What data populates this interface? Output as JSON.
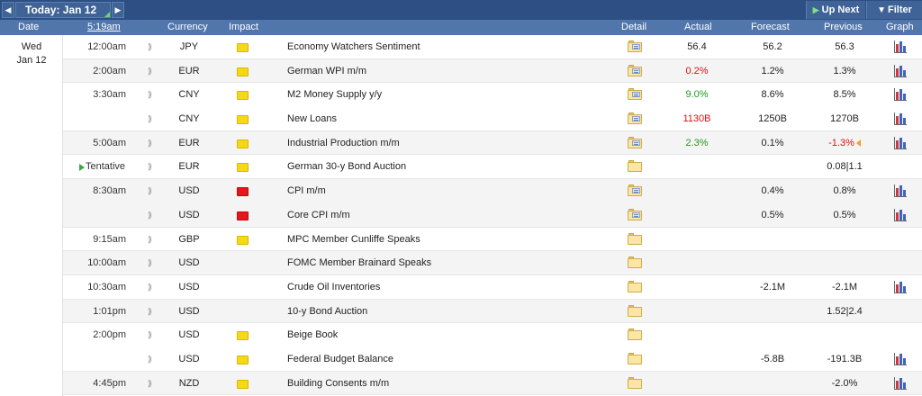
{
  "toolbar": {
    "prev_arrow": "◀",
    "next_arrow": "▶",
    "today_label": "Today: Jan 12",
    "up_next_label": "Up Next",
    "filter_label": "Filter"
  },
  "columns": {
    "date": "Date",
    "time": "5:19am",
    "currency": "Currency",
    "impact": "Impact",
    "detail": "Detail",
    "actual": "Actual",
    "forecast": "Forecast",
    "previous": "Previous",
    "graph": "Graph"
  },
  "date_group": {
    "weekday": "Wed",
    "day": "Jan 12"
  },
  "colors": {
    "header_bar": "#2d4f83",
    "column_bar": "#5076ac",
    "impact_low": "#f5d816",
    "impact_medium": "#f39a31",
    "impact_high": "#e4171b",
    "better_than_forecast": "#229922",
    "worse_than_forecast": "#dd1111"
  },
  "events": [
    {
      "time": "12:00am",
      "currency": "JPY",
      "impact": "low",
      "event": "Economy Watchers Sentiment",
      "detail_icon": "folder-doc-icon",
      "actual": "56.4",
      "actual_status": "",
      "forecast": "56.2",
      "previous": "56.3",
      "previous_status": "",
      "revised": false,
      "graph": true
    },
    {
      "time": "2:00am",
      "currency": "EUR",
      "impact": "low",
      "event": "German WPI m/m",
      "detail_icon": "folder-doc-icon",
      "actual": "0.2%",
      "actual_status": "worse",
      "forecast": "1.2%",
      "previous": "1.3%",
      "previous_status": "",
      "revised": false,
      "graph": true
    },
    {
      "time": "3:30am",
      "currency": "CNY",
      "impact": "low",
      "event": "M2 Money Supply y/y",
      "detail_icon": "folder-doc-icon",
      "actual": "9.0%",
      "actual_status": "better",
      "forecast": "8.6%",
      "previous": "8.5%",
      "previous_status": "",
      "revised": false,
      "graph": true
    },
    {
      "time": "",
      "currency": "CNY",
      "impact": "low",
      "event": "New Loans",
      "detail_icon": "folder-doc-icon",
      "actual": "1130B",
      "actual_status": "worse",
      "forecast": "1250B",
      "previous": "1270B",
      "previous_status": "",
      "revised": false,
      "graph": true
    },
    {
      "time": "5:00am",
      "currency": "EUR",
      "impact": "low",
      "event": "Industrial Production m/m",
      "detail_icon": "folder-doc-icon",
      "actual": "2.3%",
      "actual_status": "better",
      "forecast": "0.1%",
      "previous": "-1.3%",
      "previous_status": "worse",
      "revised": true,
      "graph": true
    },
    {
      "time": "Tentative",
      "currency": "EUR",
      "impact": "low",
      "event": "German 30-y Bond Auction",
      "detail_icon": "folder-icon",
      "actual": "",
      "actual_status": "",
      "forecast": "",
      "previous": "0.08|1.1",
      "previous_status": "",
      "revised": false,
      "graph": false
    },
    {
      "time": "8:30am",
      "currency": "USD",
      "impact": "high",
      "event": "CPI m/m",
      "detail_icon": "folder-doc-icon",
      "actual": "",
      "actual_status": "",
      "forecast": "0.4%",
      "previous": "0.8%",
      "previous_status": "",
      "revised": false,
      "graph": true
    },
    {
      "time": "",
      "currency": "USD",
      "impact": "high",
      "event": "Core CPI m/m",
      "detail_icon": "folder-doc-icon",
      "actual": "",
      "actual_status": "",
      "forecast": "0.5%",
      "previous": "0.5%",
      "previous_status": "",
      "revised": false,
      "graph": true
    },
    {
      "time": "9:15am",
      "currency": "GBP",
      "impact": "low",
      "event": "MPC Member Cunliffe Speaks",
      "detail_icon": "folder-icon",
      "actual": "",
      "actual_status": "",
      "forecast": "",
      "previous": "",
      "previous_status": "",
      "revised": false,
      "graph": false
    },
    {
      "time": "10:00am",
      "currency": "USD",
      "impact": "medium",
      "event": "FOMC Member Brainard Speaks",
      "detail_icon": "folder-icon",
      "actual": "",
      "actual_status": "",
      "forecast": "",
      "previous": "",
      "previous_status": "",
      "revised": false,
      "graph": false
    },
    {
      "time": "10:30am",
      "currency": "USD",
      "impact": "medium",
      "event": "Crude Oil Inventories",
      "detail_icon": "folder-icon",
      "actual": "",
      "actual_status": "",
      "forecast": "-2.1M",
      "previous": "-2.1M",
      "previous_status": "",
      "revised": false,
      "graph": true
    },
    {
      "time": "1:01pm",
      "currency": "USD",
      "impact": "medium",
      "event": "10-y Bond Auction",
      "detail_icon": "folder-icon",
      "actual": "",
      "actual_status": "",
      "forecast": "",
      "previous": "1.52|2.4",
      "previous_status": "",
      "revised": false,
      "graph": false
    },
    {
      "time": "2:00pm",
      "currency": "USD",
      "impact": "low",
      "event": "Beige Book",
      "detail_icon": "folder-icon",
      "actual": "",
      "actual_status": "",
      "forecast": "",
      "previous": "",
      "previous_status": "",
      "revised": false,
      "graph": false
    },
    {
      "time": "",
      "currency": "USD",
      "impact": "low",
      "event": "Federal Budget Balance",
      "detail_icon": "folder-icon",
      "actual": "",
      "actual_status": "",
      "forecast": "-5.8B",
      "previous": "-191.3B",
      "previous_status": "",
      "revised": false,
      "graph": true
    },
    {
      "time": "4:45pm",
      "currency": "NZD",
      "impact": "low",
      "event": "Building Consents m/m",
      "detail_icon": "folder-icon",
      "actual": "",
      "actual_status": "",
      "forecast": "",
      "previous": "-2.0%",
      "previous_status": "",
      "revised": false,
      "graph": true
    }
  ]
}
